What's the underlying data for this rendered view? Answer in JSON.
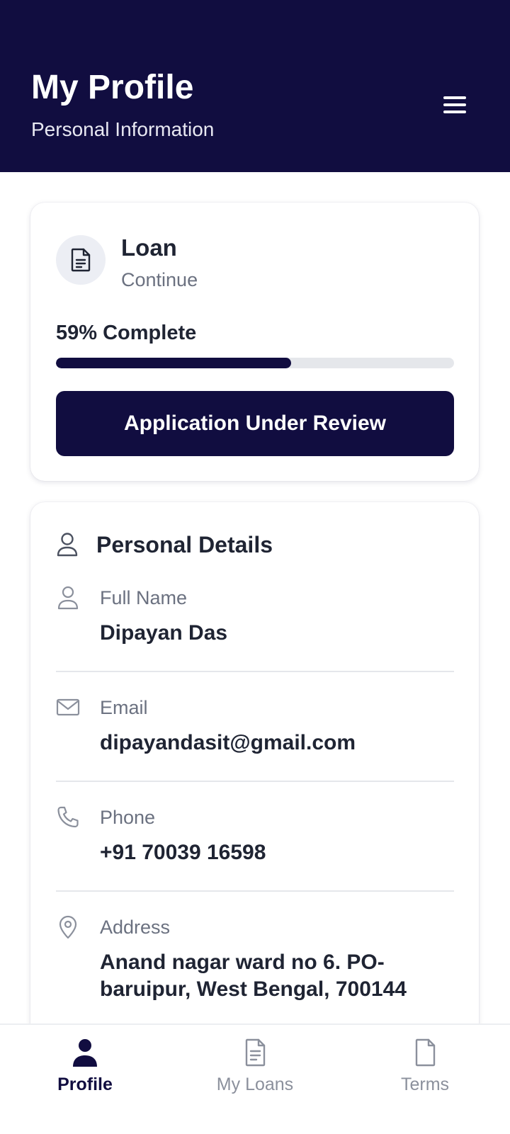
{
  "colors": {
    "header_bg": "#110d40",
    "accent": "#110d40",
    "muted_text": "#6b7180",
    "divider": "#e5e7eb"
  },
  "header": {
    "title": "My Profile",
    "subtitle": "Personal Information",
    "menu_icon": "hamburger-icon"
  },
  "loan_card": {
    "icon": "document-icon",
    "title": "Loan",
    "status": "Continue",
    "progress_percent": 59,
    "progress_label": "59% Complete",
    "button_label": "Application Under Review"
  },
  "personal_details": {
    "title": "Personal Details",
    "icon": "user-icon",
    "fields": [
      {
        "icon": "user-icon",
        "label": "Full Name",
        "value": "Dipayan Das"
      },
      {
        "icon": "mail-icon",
        "label": "Email",
        "value": "dipayandasit@gmail.com"
      },
      {
        "icon": "phone-icon",
        "label": "Phone",
        "value": "+91 70039 16598"
      },
      {
        "icon": "location-pin-icon",
        "label": "Address",
        "value": "Anand nagar ward no 6. PO- baruipur, West Bengal, 700144"
      }
    ]
  },
  "bottom_nav": {
    "items": [
      {
        "label": "Profile",
        "icon": "person-filled-icon",
        "active": true
      },
      {
        "label": "My Loans",
        "icon": "document-icon",
        "active": false
      },
      {
        "label": "Terms",
        "icon": "file-icon",
        "active": false
      }
    ]
  }
}
